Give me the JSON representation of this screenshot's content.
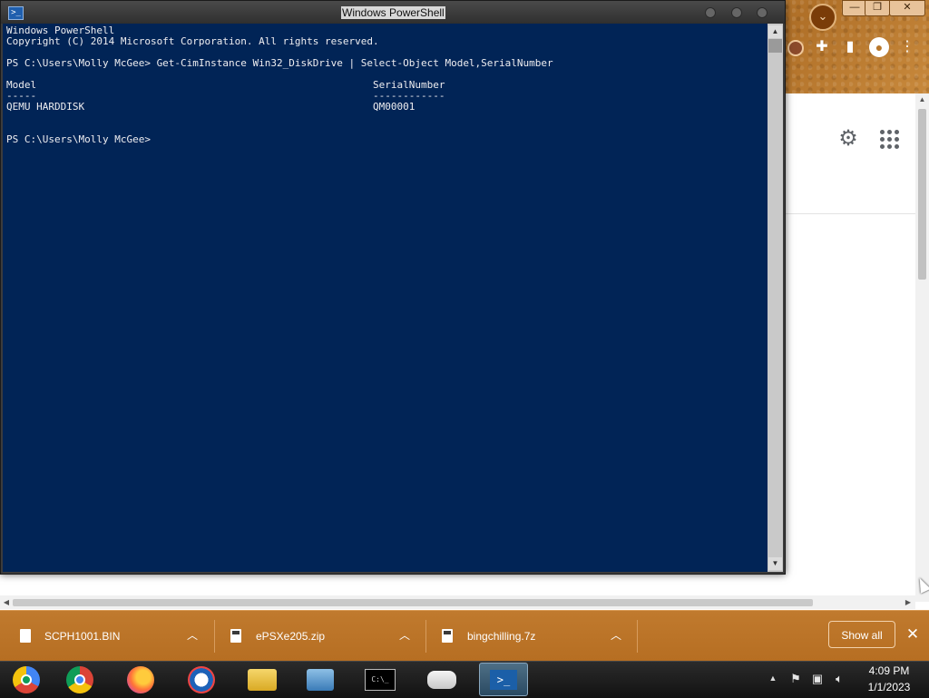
{
  "browser": {
    "controls": {
      "minimize": "—",
      "maximize": "❐",
      "close": "✕"
    },
    "profile_chip_glyph": "⌄",
    "toolbar_icons": [
      "extensions-icon",
      "sidebar-icon",
      "profile-icon",
      "menu-icon"
    ]
  },
  "powershell": {
    "title": "Windows PowerShell",
    "icon_glyph": ">_",
    "console_lines": [
      "Windows PowerShell",
      "Copyright (C) 2014 Microsoft Corporation. All rights reserved.",
      "",
      "PS C:\\Users\\Molly McGee> Get-CimInstance Win32_DiskDrive | Select-Object Model,SerialNumber",
      "",
      "Model                                                        SerialNumber",
      "-----                                                        ------------",
      "QEMU HARDDISK                                                QM00001",
      "",
      "",
      "PS C:\\Users\\Molly McGee>"
    ],
    "output_table": {
      "columns": [
        "Model",
        "SerialNumber"
      ],
      "rows": [
        [
          "QEMU HARDDISK",
          "QM00001"
        ]
      ]
    }
  },
  "downloads": {
    "items": [
      {
        "name": "SCPH1001.BIN",
        "icon": "file-icon"
      },
      {
        "name": "ePSXe205.zip",
        "icon": "zip-icon"
      },
      {
        "name": "bingchilling.7z",
        "icon": "zip-icon"
      }
    ],
    "show_all_label": "Show all",
    "close_glyph": "✕"
  },
  "taskbar": {
    "apps": [
      "chrome-icon",
      "chrome-icon",
      "firefox-icon",
      "outlook-icon",
      "file-explorer-icon",
      "network-icon",
      "command-prompt-icon",
      "gamepad-icon",
      "powershell-icon"
    ],
    "cmd_glyph": "C:\\_",
    "ps_glyph": ">_",
    "clock": {
      "time": "4:09 PM",
      "date": "1/1/2023"
    }
  },
  "colors": {
    "console_bg": "#012456",
    "console_text": "#eeedf0",
    "download_bar": "#b66e22",
    "taskbar": "#121212"
  }
}
